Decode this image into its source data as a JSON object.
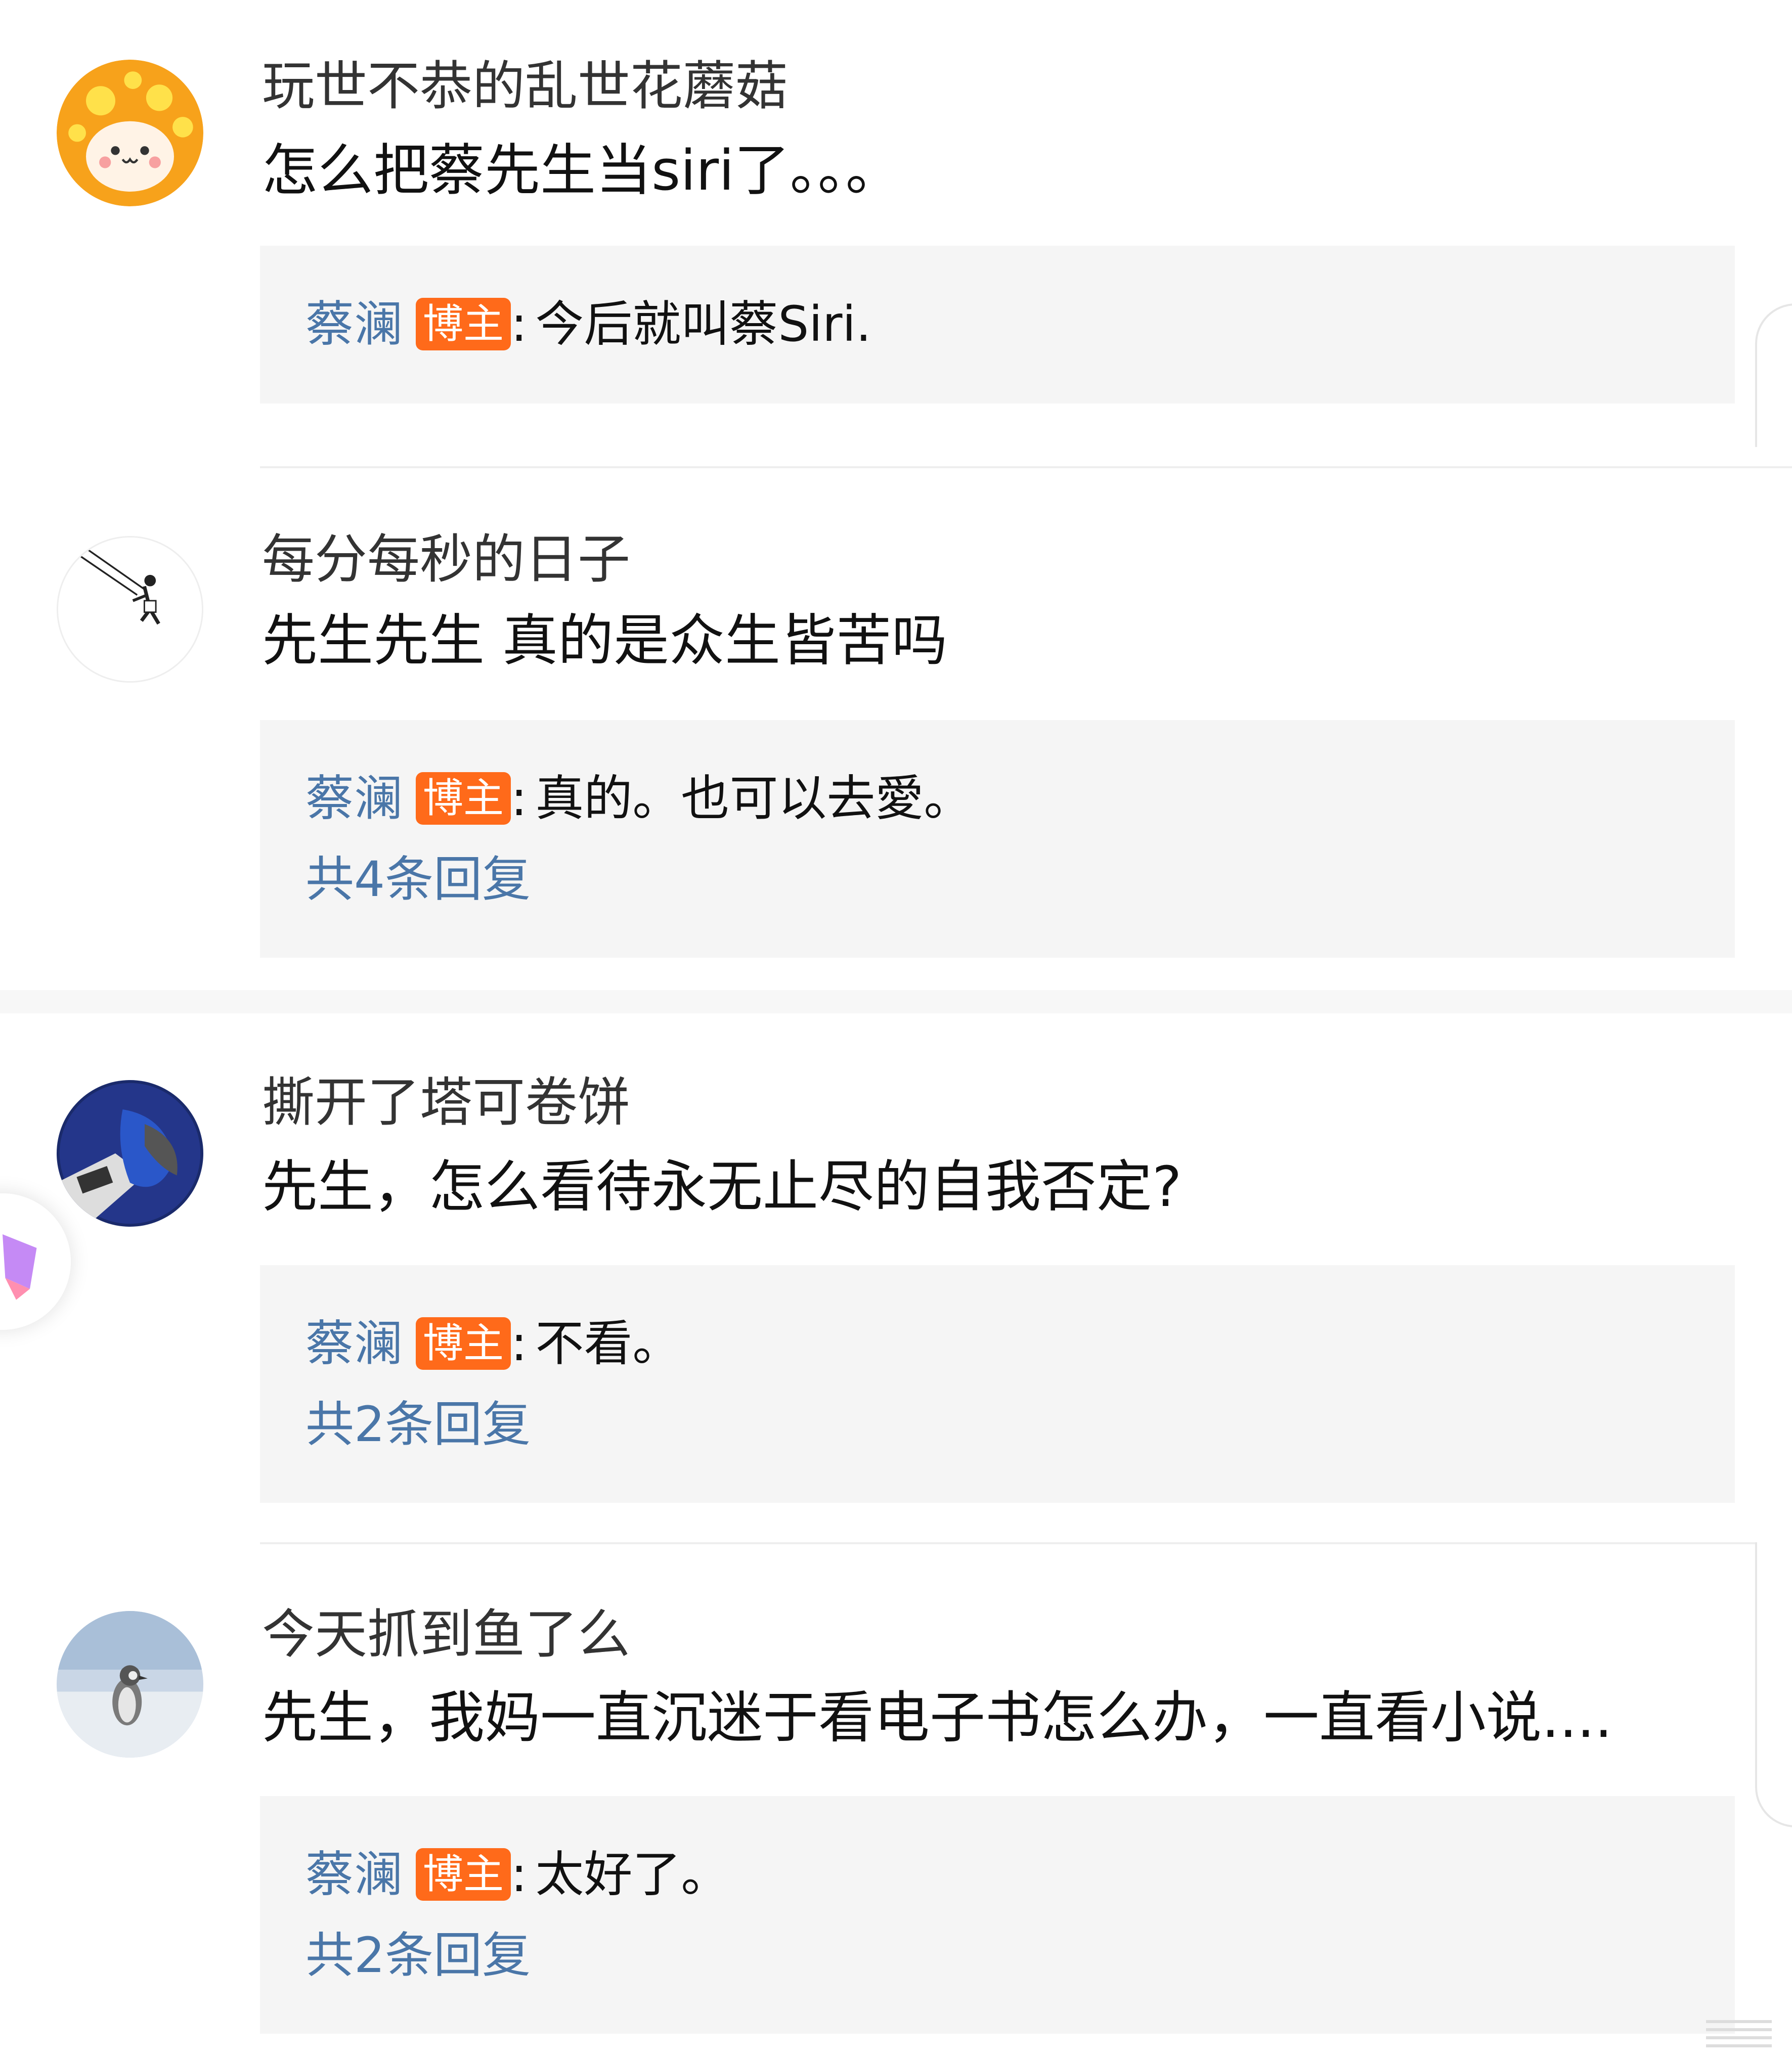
{
  "colors": {
    "author_link": "#4a76a8",
    "host_badge_bg": "#ff6a1a",
    "reply_bg": "#f5f5f5"
  },
  "comments": [
    {
      "username": "玩世不恭的乱世花蘑菇",
      "text": "怎么把蔡先生当siri了。。。",
      "avatar_icon": "mushroom-avatar-icon",
      "reply": {
        "author": "蔡澜",
        "badge": "博主",
        "colon": ":",
        "text": "今后就叫蔡Siri."
      }
    },
    {
      "username": "每分每秒的日子",
      "text": "先生先生 真的是众生皆苦吗",
      "avatar_icon": "swing-sketch-avatar-icon",
      "reply": {
        "author": "蔡澜",
        "badge": "博主",
        "colon": ":",
        "text": "真的。也可以去愛。"
      },
      "more_replies": "共4条回复"
    },
    {
      "username": "撕开了塔可卷饼",
      "text": "先生，怎么看待永无止尽的自我否定?",
      "avatar_icon": "photo-avatar-icon",
      "reply": {
        "author": "蔡澜",
        "badge": "博主",
        "colon": ":",
        "text": "不看。"
      },
      "more_replies": "共2条回复"
    },
    {
      "username": "今天抓到鱼了么",
      "text": "先生，我妈一直沉迷于看电子书怎么办，一直看小说....",
      "avatar_icon": "penguin-avatar-icon",
      "reply": {
        "author": "蔡澜",
        "badge": "博主",
        "colon": ":",
        "text": "太好了。"
      },
      "more_replies": "共2条回复"
    }
  ]
}
